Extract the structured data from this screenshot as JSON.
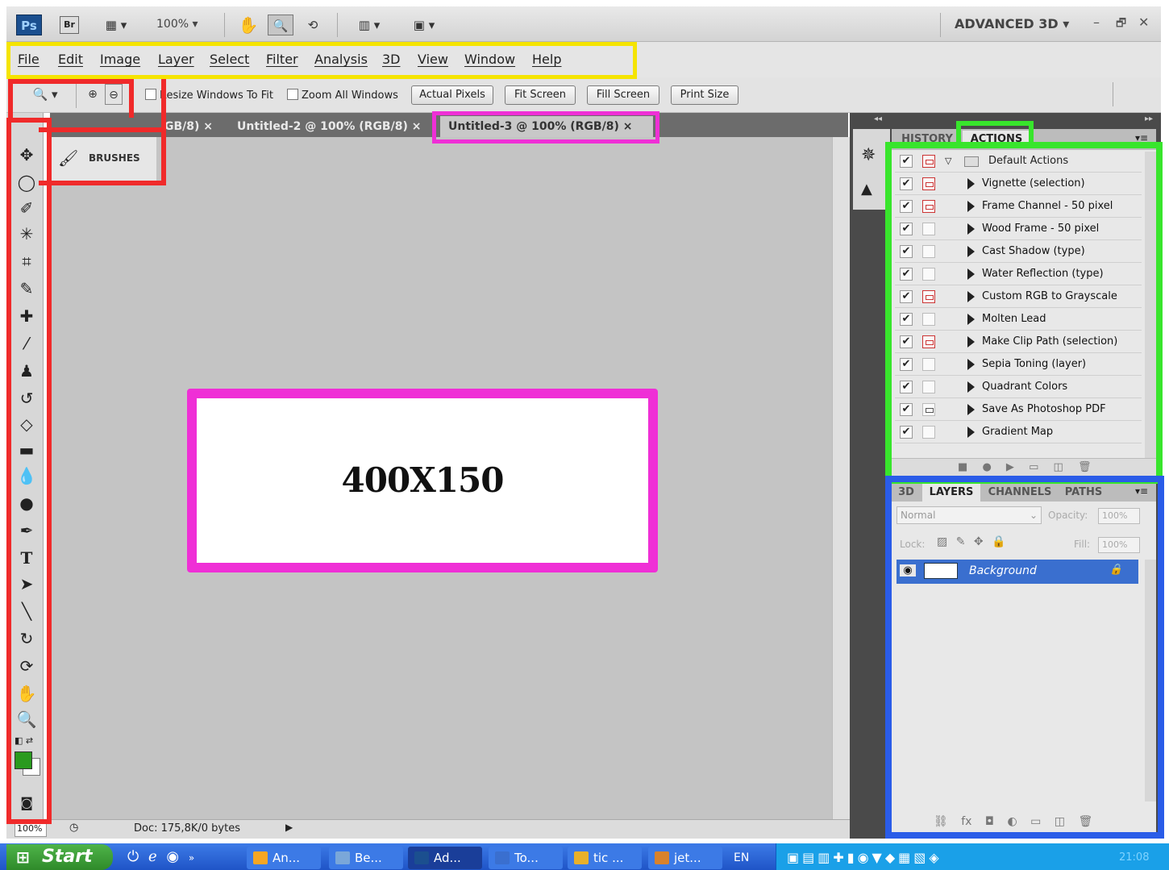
{
  "app": {
    "logo": "Ps",
    "bridge": "Br",
    "zoom": "100%",
    "workspace": "ADVANCED 3D",
    "win_min": "–",
    "win_restore": "🗗",
    "win_close": "✕"
  },
  "menu": [
    "File",
    "Edit",
    "Image",
    "Layer",
    "Select",
    "Filter",
    "Analysis",
    "3D",
    "View",
    "Window",
    "Help"
  ],
  "options": {
    "resize_windows": "Resize Windows To Fit",
    "zoom_all": "Zoom All Windows",
    "actual_pixels": "Actual Pixels",
    "fit_screen": "Fit Screen",
    "fill_screen": "Fill Screen",
    "print_size": "Print Size"
  },
  "doc_tabs": [
    {
      "label": "GB/8)",
      "close": "×"
    },
    {
      "label": "Untitled-2 @ 100% (RGB/8)",
      "close": "×"
    },
    {
      "label": "Untitled-3 @ 100% (RGB/8)",
      "close": "×"
    }
  ],
  "brushes_label": "BRUSHES",
  "canvas_text": "400X150",
  "status": {
    "zoom": "100%",
    "doc": "Doc: 175,8K/0 bytes"
  },
  "panel_tabs_top": [
    "HISTORY",
    "ACTIONS"
  ],
  "actions": {
    "set_name": "Default Actions",
    "items": [
      {
        "label": "Vignette (selection)",
        "dialog": "red"
      },
      {
        "label": "Frame Channel - 50 pixel",
        "dialog": "red"
      },
      {
        "label": "Wood Frame - 50 pixel",
        "dialog": "none"
      },
      {
        "label": "Cast Shadow (type)",
        "dialog": "none"
      },
      {
        "label": "Water Reflection (type)",
        "dialog": "none"
      },
      {
        "label": "Custom RGB to Grayscale",
        "dialog": "red"
      },
      {
        "label": "Molten Lead",
        "dialog": "none"
      },
      {
        "label": "Make Clip Path (selection)",
        "dialog": "red"
      },
      {
        "label": "Sepia Toning (layer)",
        "dialog": "none"
      },
      {
        "label": "Quadrant Colors",
        "dialog": "none"
      },
      {
        "label": "Save As Photoshop PDF",
        "dialog": "gray"
      },
      {
        "label": "Gradient Map",
        "dialog": "none"
      }
    ]
  },
  "panel_tabs_bottom": [
    "3D",
    "LAYERS",
    "CHANNELS",
    "PATHS"
  ],
  "layers": {
    "blend": "Normal",
    "opacity_label": "Opacity:",
    "opacity": "100%",
    "lock_label": "Lock:",
    "fill_label": "Fill:",
    "fill": "100%",
    "background": "Background"
  },
  "taskbar": {
    "start": "Start",
    "tasks": [
      "An...",
      "Be...",
      "Ad...",
      "To...",
      "tic ...",
      "jet..."
    ],
    "lang": "EN",
    "clock": "21:08"
  },
  "colors": {
    "highlight_yellow": "#f5e400",
    "highlight_red": "#f02a2a",
    "highlight_magenta": "#ef2fd6",
    "highlight_green": "#38e52c",
    "highlight_blue": "#2a5ce8",
    "foreground_swatch": "#2a9a1e"
  }
}
